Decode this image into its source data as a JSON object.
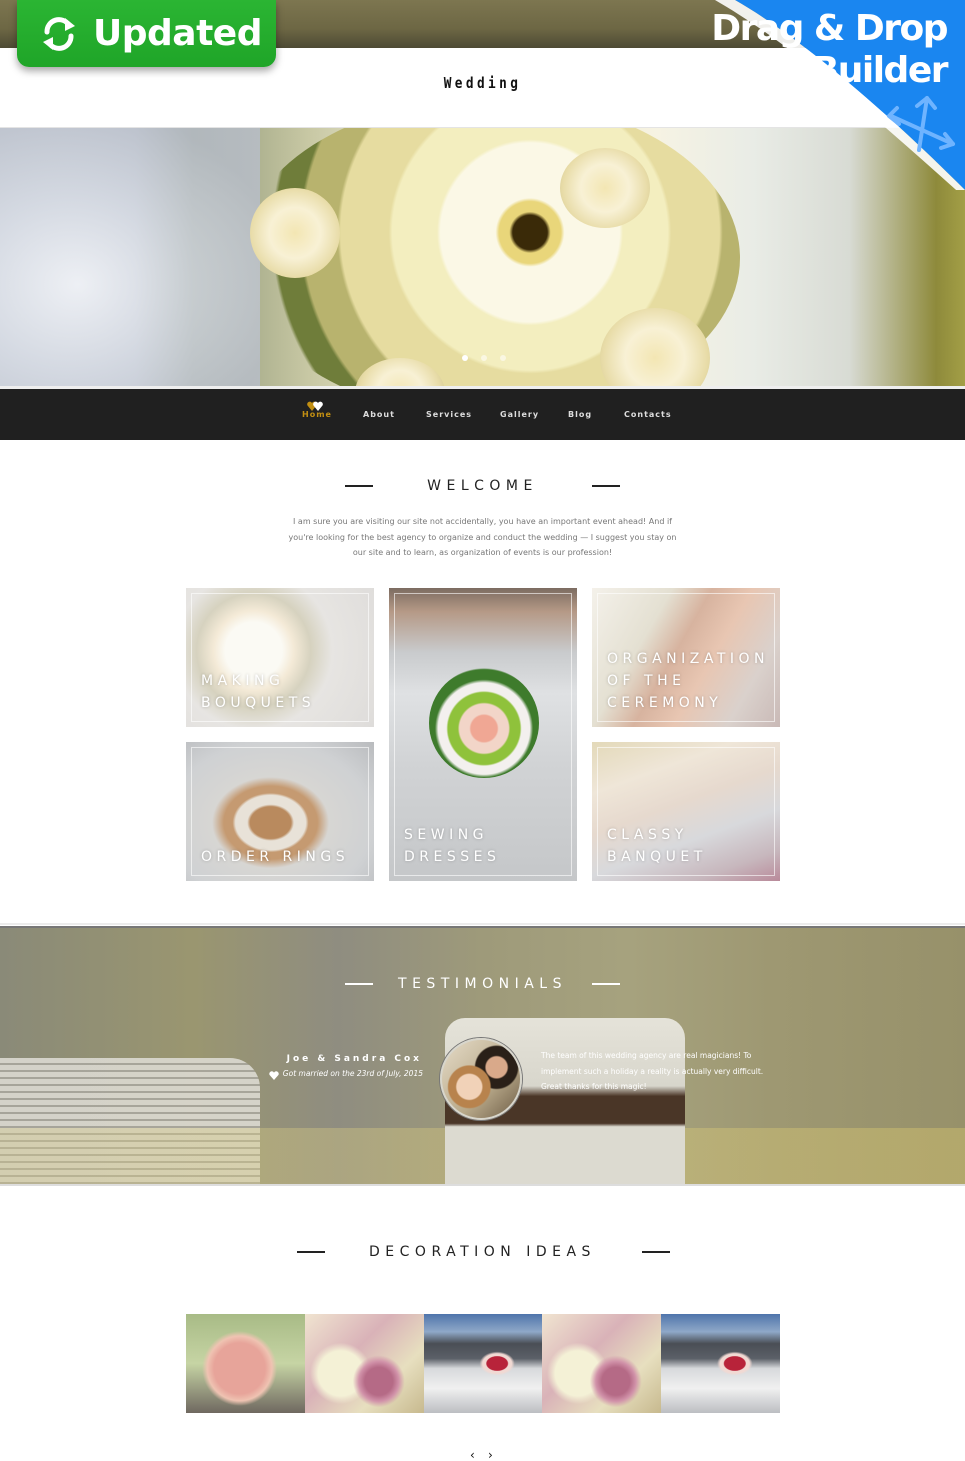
{
  "promo": {
    "updated_label": "Updated",
    "corner_line1": "Drag & Drop",
    "corner_line2": "Builder",
    "updated_color": "#1fa528",
    "corner_color": "#1a86f0"
  },
  "header": {
    "title": "Wedding"
  },
  "hero": {
    "slides": 3,
    "active_slide": 1
  },
  "nav": {
    "items": [
      {
        "label": "Home",
        "active": true
      },
      {
        "label": "About",
        "active": false
      },
      {
        "label": "Services",
        "active": false
      },
      {
        "label": "Gallery",
        "active": false
      },
      {
        "label": "Blog",
        "active": false
      },
      {
        "label": "Contacts",
        "active": false
      }
    ],
    "accent_color": "#c28f12"
  },
  "welcome": {
    "title": "WELCOME",
    "text": "I am sure you are visiting our site not accidentally, you have an important event ahead! And if you're looking for the best agency to organize and conduct the wedding — I suggest you stay on our site and to learn, as organization of events is our profession!"
  },
  "services": [
    {
      "caption": "MAKING\nBOUQUETS"
    },
    {
      "caption": "ORDER RINGS"
    },
    {
      "caption": "SEWING\nDRESSES"
    },
    {
      "caption": "ORGANIZATION\nOF THE\nCEREMONY"
    },
    {
      "caption": "CLASSY\nBANQUET"
    }
  ],
  "testimonials": {
    "title": "TESTIMONIALS",
    "name": "Joe & Sandra Cox",
    "date": "Got married on the 23rd of July, 2015",
    "quote": "The team of this wedding agency are real magicians! To implement such a holiday a reality is actually very difficult. Great thanks for this magic!"
  },
  "decoration": {
    "title": "DECORATION IDEAS",
    "images": [
      "rose-bouquet",
      "orchids-and-rose",
      "decorated-limousine",
      "orchids-and-rose",
      "decorated-limousine"
    ],
    "prev_label": "‹",
    "next_label": "›"
  }
}
